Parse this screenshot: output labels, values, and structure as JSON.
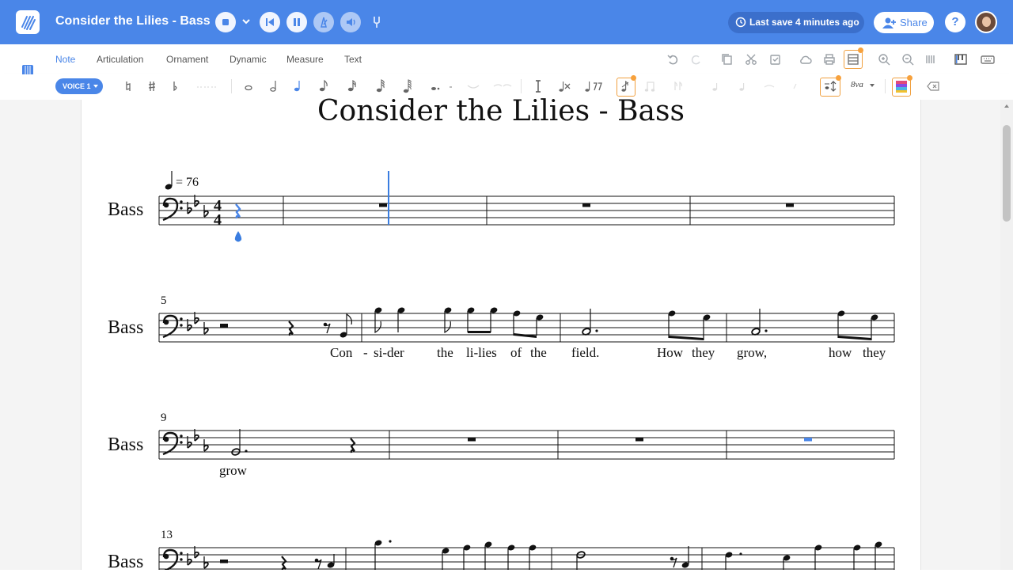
{
  "app": {
    "title": "Consider the Lilies - Bass",
    "save_status": "Last save 4 minutes ago",
    "share_label": "Share",
    "help_label": "?"
  },
  "tabs": [
    "Note",
    "Articulation",
    "Ornament",
    "Dynamic",
    "Measure",
    "Text"
  ],
  "active_tab": "Note",
  "voice_label": "VOICE 1",
  "octave_label": "8va",
  "score": {
    "title": "Consider the Lilies - Bass",
    "instrument": "Bass",
    "tempo_text": "= 76",
    "systems": [
      {
        "measure_number": "",
        "lyrics": []
      },
      {
        "measure_number": "5",
        "lyrics": [
          "Con",
          "-",
          "si-der",
          "the",
          "li-lies",
          "of",
          "the",
          "field.",
          "How",
          "they",
          "grow,",
          "how",
          "they"
        ]
      },
      {
        "measure_number": "9",
        "lyrics": [
          "grow"
        ]
      },
      {
        "measure_number": "13",
        "lyrics": []
      }
    ]
  },
  "colors": {
    "brand_blue": "#4a86e8",
    "selection_blue": "#3a7de0",
    "badge_orange": "#f7a13c"
  },
  "icons": {
    "topbar": [
      "logo-icon",
      "stop-icon",
      "chevron-down-icon",
      "rewind-icon",
      "pause-icon",
      "metronome-icon",
      "volume-icon",
      "tuning-fork-icon",
      "clock-icon",
      "add-user-icon",
      "avatar"
    ],
    "toolbar_right": [
      "undo-icon",
      "redo-icon",
      "copy-icon",
      "cut-icon",
      "paste-icon",
      "cloud-icon",
      "print-icon",
      "layout-icon",
      "zoom-in-icon",
      "zoom-out-icon",
      "barlines-icon",
      "piano-keys-icon",
      "keyboard-icon"
    ]
  }
}
